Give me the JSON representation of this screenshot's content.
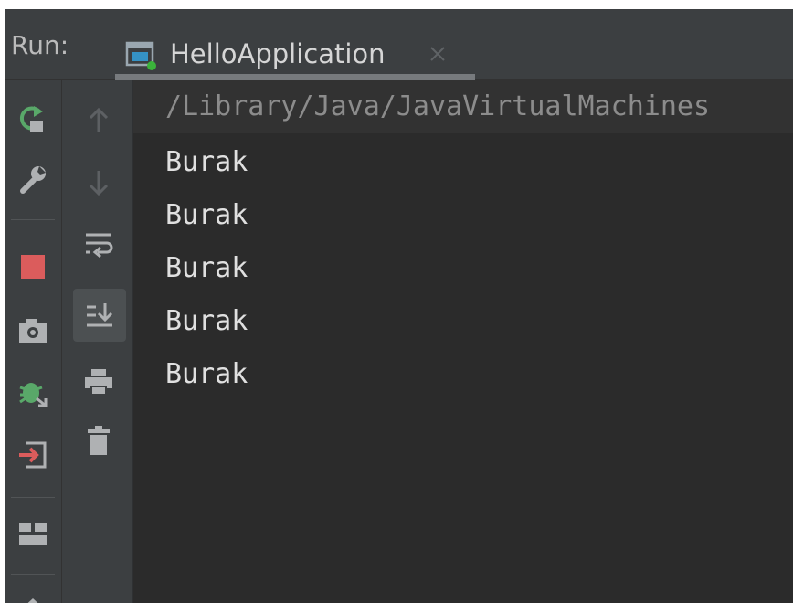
{
  "header": {
    "run_label": "Run:",
    "tab": {
      "title": "HelloApplication",
      "icon": "application-window-icon",
      "close_icon": "close-icon"
    }
  },
  "toolbar_left": [
    {
      "name": "rerun-icon",
      "color": "#59a869"
    },
    {
      "name": "wrench-icon",
      "color": "#afb1b3"
    },
    {
      "name": "stop-icon",
      "color": "#db5c5c"
    },
    {
      "name": "camera-icon",
      "color": "#afb1b3"
    },
    {
      "name": "debug-bug-icon",
      "color": "#59a869"
    },
    {
      "name": "login-icon",
      "color": "#db5c5c"
    },
    {
      "name": "layout-icon",
      "color": "#afb1b3"
    },
    {
      "name": "pin-icon",
      "color": "#afb1b3"
    }
  ],
  "toolbar_right": [
    {
      "name": "up-arrow-icon",
      "color": "#5d6063"
    },
    {
      "name": "down-arrow-icon",
      "color": "#5d6063"
    },
    {
      "name": "soft-wrap-icon",
      "color": "#afb1b3"
    },
    {
      "name": "scroll-to-end-icon",
      "color": "#afb1b3"
    },
    {
      "name": "print-icon",
      "color": "#afb1b3"
    },
    {
      "name": "trash-icon",
      "color": "#afb1b3"
    }
  ],
  "console": {
    "command": "/Library/Java/JavaVirtualMachines",
    "lines": [
      "Burak",
      "Burak",
      "Burak",
      "Burak",
      "Burak"
    ]
  }
}
